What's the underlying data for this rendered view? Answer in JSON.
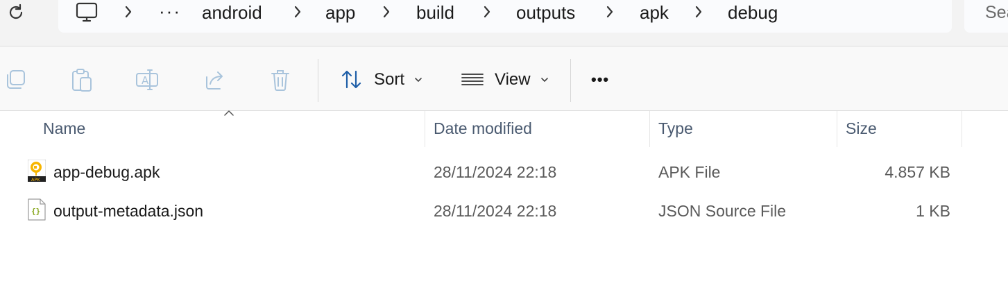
{
  "breadcrumb": {
    "overflow": "···",
    "items": [
      "android",
      "app",
      "build",
      "outputs",
      "apk",
      "debug"
    ]
  },
  "search": {
    "placeholder": "Sea"
  },
  "toolbar": {
    "sort_label": "Sort",
    "view_label": "View",
    "more_label": "•••"
  },
  "columns": {
    "name": "Name",
    "date_modified": "Date modified",
    "type": "Type",
    "size": "Size"
  },
  "files": [
    {
      "name": "app-debug.apk",
      "date_modified": "28/11/2024 22:18",
      "type": "APK File",
      "size": "4.857 KB",
      "icon": "apk-file-icon"
    },
    {
      "name": "output-metadata.json",
      "date_modified": "28/11/2024 22:18",
      "type": "JSON Source File",
      "size": "1 KB",
      "icon": "json-file-icon"
    }
  ],
  "colors": {
    "accent": "#1f5fa8",
    "header_text": "#4a5a70",
    "disabled_icon": "#a9c4dc"
  }
}
